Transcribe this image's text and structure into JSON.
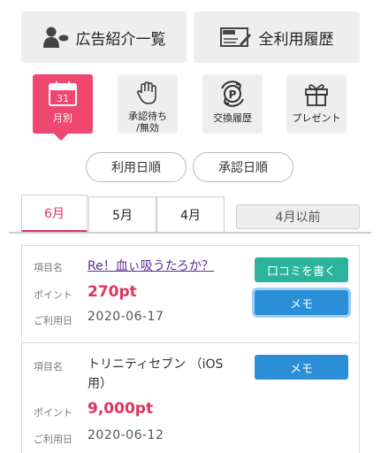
{
  "top_buttons": {
    "ads": "広告紹介一覧",
    "history": "全利用履歴"
  },
  "tiles": [
    {
      "label": "月別",
      "icon_text": "31",
      "icon": "calendar-icon",
      "active": true
    },
    {
      "label": "承認待ち\n/無効",
      "icon": "hand-icon",
      "active": false
    },
    {
      "label": "交換履歴",
      "icon": "points-exchange-icon",
      "active": false
    },
    {
      "label": "プレゼント",
      "icon": "gift-icon",
      "active": false
    }
  ],
  "sort": {
    "usage_date": "利用日順",
    "approval_date": "承認日順"
  },
  "tabs": {
    "june": "6月",
    "may": "5月",
    "april": "4月",
    "before_april": "4月以前"
  },
  "labels": {
    "item": "項目名",
    "point": "ポイント",
    "date": "ご利用日"
  },
  "entries": [
    {
      "title": "Re！血ぃ吸うたろか？",
      "points": "270pt",
      "date": "2020-06-17",
      "review_button": "口コミを書く",
      "memo_button": "メモ"
    },
    {
      "title_line1": "トリニティセブン （iOS",
      "title_line2": "用）",
      "points": "9,000pt",
      "date": "2020-06-12",
      "memo_button": "メモ"
    }
  ],
  "colors": {
    "accent": "#ef476f",
    "points": "#e0335e",
    "review": "#2bb39c",
    "memo": "#2a8fd6"
  }
}
